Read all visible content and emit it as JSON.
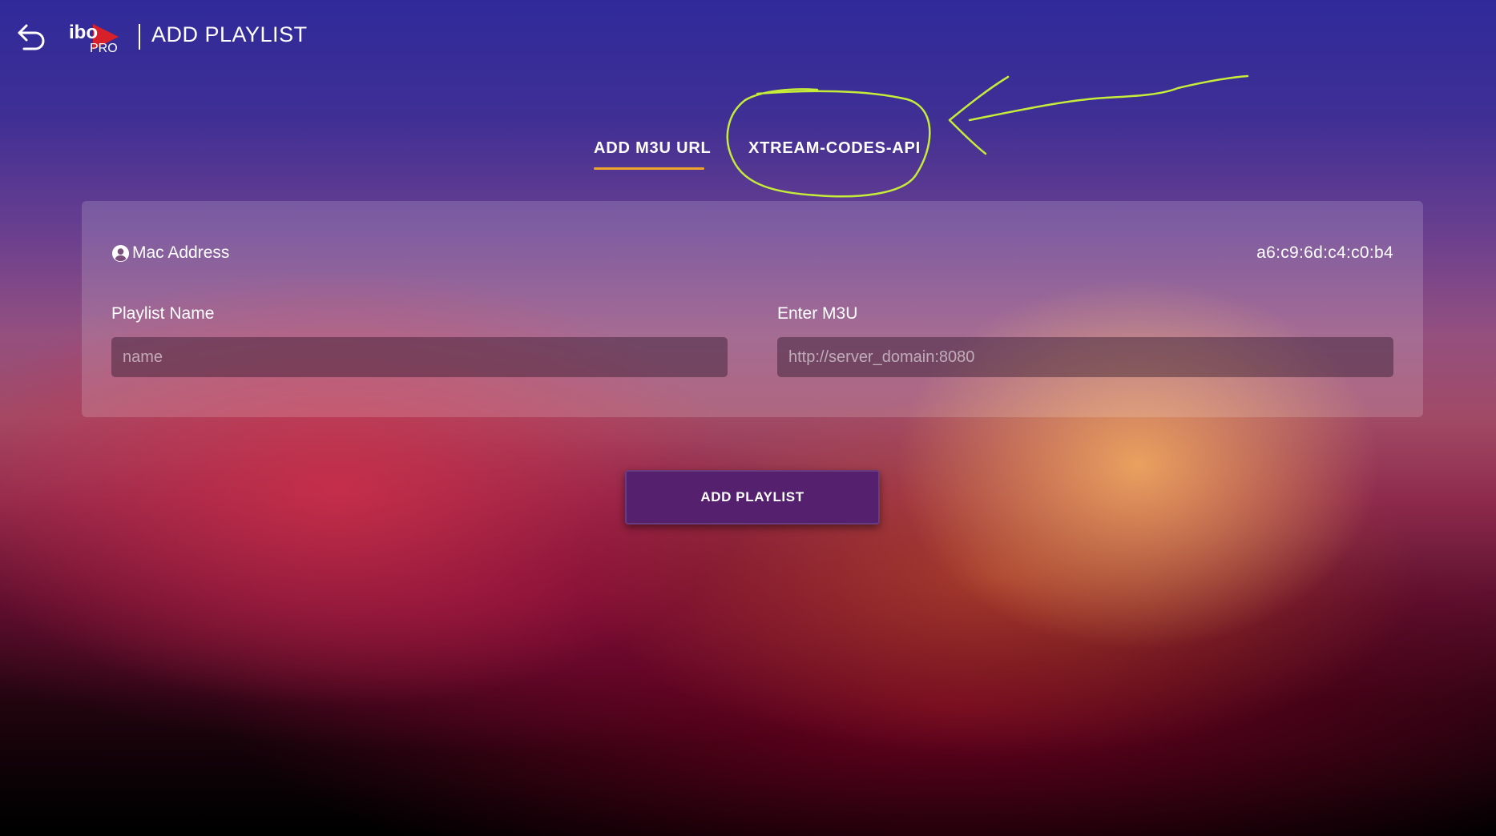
{
  "header": {
    "back_icon": "back-arrow-icon",
    "logo_text": "ibo",
    "logo_sub": "PRO",
    "title": "ADD PLAYLIST"
  },
  "tabs": [
    {
      "label": "ADD M3U URL",
      "active": true
    },
    {
      "label": "XTREAM-CODES-API",
      "active": false
    }
  ],
  "annotation": {
    "color": "#c6ec3a",
    "shapes": [
      "circle",
      "arrow"
    ]
  },
  "form": {
    "mac_icon": "user-circle-icon",
    "mac_label": "Mac Address",
    "mac_value": "a6:c9:6d:c4:c0:b4",
    "playlist_name_label": "Playlist Name",
    "playlist_name_placeholder": "name",
    "playlist_name_value": "",
    "m3u_label": "Enter M3U",
    "m3u_placeholder": "http://server_domain:8080",
    "m3u_value": ""
  },
  "actions": {
    "add_label": "ADD PLAYLIST"
  },
  "colors": {
    "accent_underline": "#f0a52a",
    "button_bg": "#55206e"
  }
}
